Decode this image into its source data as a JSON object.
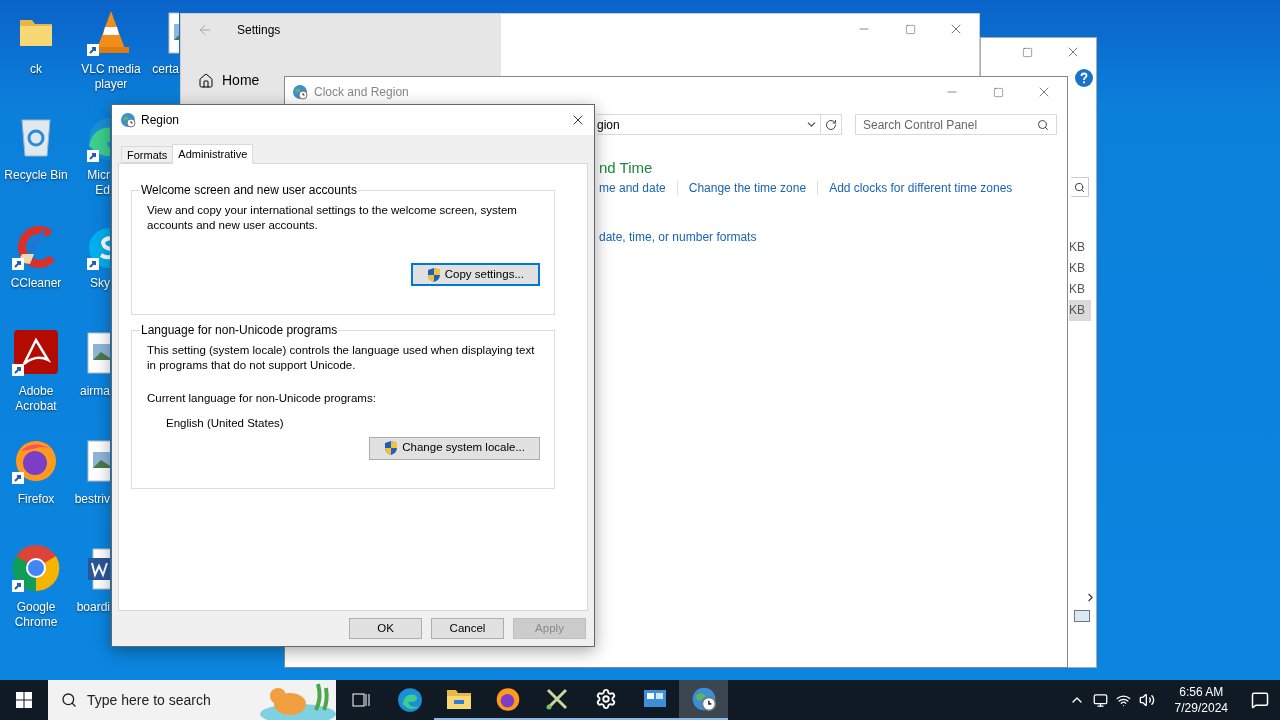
{
  "desktop_icons": [
    {
      "label": [
        "ck"
      ],
      "kind": "folder",
      "shortcut": false
    },
    {
      "label": [
        "Recycle Bin"
      ],
      "kind": "recycle",
      "shortcut": false
    },
    {
      "label": [
        "CCleaner"
      ],
      "kind": "ccleaner",
      "shortcut": true
    },
    {
      "label": [
        "Adobe",
        "Acrobat"
      ],
      "kind": "acrobat",
      "shortcut": true
    },
    {
      "label": [
        "Firefox"
      ],
      "kind": "firefox",
      "shortcut": true
    },
    {
      "label": [
        "Google",
        "Chrome"
      ],
      "kind": "chrome",
      "shortcut": true
    },
    {
      "label": [
        "VLC media",
        "player"
      ],
      "kind": "vlc",
      "shortcut": true
    },
    {
      "label": [
        "Micr",
        "Ed"
      ],
      "kind": "edge",
      "shortcut": true
    },
    {
      "label": [
        "Sky"
      ],
      "kind": "skype",
      "shortcut": true
    },
    {
      "label": [
        "airma"
      ],
      "kind": "image",
      "shortcut": false
    },
    {
      "label": [
        "bestriv"
      ],
      "kind": "image",
      "shortcut": false
    },
    {
      "label": [
        "boardi"
      ],
      "kind": "word",
      "shortcut": false
    },
    {
      "label": [
        "certa"
      ],
      "kind": "image",
      "shortcut": false
    }
  ],
  "back_window": {
    "rows": [
      {
        "text": "KB",
        "selected": false
      },
      {
        "text": "KB",
        "selected": false
      },
      {
        "text": "KB",
        "selected": false
      },
      {
        "text": "KB",
        "selected": true
      }
    ]
  },
  "settings_window": {
    "title": "Settings",
    "home": "Home"
  },
  "control_panel": {
    "title": "Clock and Region",
    "address": "gion",
    "search_placeholder": "Search Control Panel",
    "heading": "nd Time",
    "links": [
      "me and date",
      "Change the time zone",
      "Add clocks for different time zones"
    ],
    "link2": "date, time, or number formats"
  },
  "region_dialog": {
    "title": "Region",
    "tabs": [
      {
        "label": "Formats",
        "selected": false
      },
      {
        "label": "Administrative",
        "selected": true
      }
    ],
    "groups": [
      {
        "legend": "Welcome screen and new user accounts",
        "text": "View and copy your international settings to the welcome screen, system accounts and new user accounts.",
        "button": {
          "label": "Copy settings...",
          "focused": true
        }
      },
      {
        "legend": "Language for non-Unicode programs",
        "text": "This setting (system locale) controls the language used when displaying text in programs that do not support Unicode.",
        "current_label": "Current language for non-Unicode programs:",
        "current_value": "English (United States)",
        "button": {
          "label": "Change system locale...",
          "focused": false
        }
      }
    ],
    "buttons": [
      {
        "label": "OK",
        "disabled": false
      },
      {
        "label": "Cancel",
        "disabled": false
      },
      {
        "label": "Apply",
        "disabled": true
      }
    ]
  },
  "taskbar": {
    "search_placeholder": "Type here to search",
    "apps": [
      {
        "kind": "task-view",
        "running": false,
        "selected": false
      },
      {
        "kind": "edge",
        "running": false,
        "selected": false
      },
      {
        "kind": "explorer",
        "running": true,
        "selected": false
      },
      {
        "kind": "firefox",
        "running": true,
        "selected": false
      },
      {
        "kind": "tool",
        "running": true,
        "selected": false
      },
      {
        "kind": "settings",
        "running": true,
        "selected": false
      },
      {
        "kind": "control-panel",
        "running": true,
        "selected": false
      },
      {
        "kind": "region",
        "running": true,
        "selected": true
      }
    ],
    "time": "6:56 AM",
    "date": "7/29/2024"
  }
}
